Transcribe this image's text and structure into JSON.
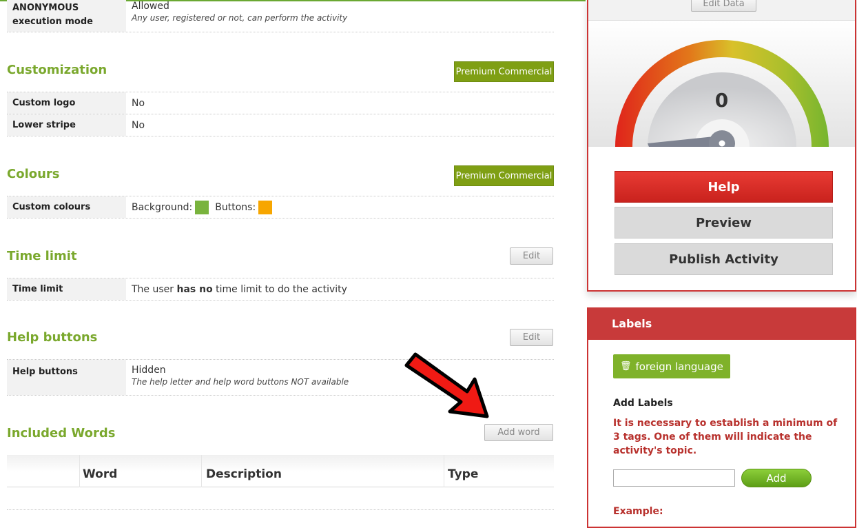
{
  "anonymous": {
    "label": "ANONYMOUS execution mode",
    "value": "Allowed",
    "sub": "Any user, registered or not, can perform the activity"
  },
  "customization": {
    "title": "Customization",
    "badge": "Premium Commercial",
    "rows": [
      {
        "label": "Custom logo",
        "value": "No"
      },
      {
        "label": "Lower stripe",
        "value": "No"
      }
    ]
  },
  "colours": {
    "title": "Colours",
    "badge": "Premium Commercial",
    "label": "Custom colours",
    "background_label": "Background:",
    "background_color": "#79b33d",
    "buttons_label": "Buttons:",
    "buttons_color": "#f7a600"
  },
  "time_limit": {
    "title": "Time limit",
    "edit": "Edit",
    "label": "Time limit",
    "value_pre": "The user ",
    "value_bold": "has no",
    "value_post": " time limit to do the activity"
  },
  "help_buttons": {
    "title": "Help buttons",
    "edit": "Edit",
    "label": "Help buttons",
    "value": "Hidden",
    "sub": "The help letter and help word buttons NOT available"
  },
  "included_words": {
    "title": "Included Words",
    "add": "Add word",
    "columns": [
      "Word",
      "Description",
      "Type"
    ]
  },
  "right_panel": {
    "edit_data": "Edit Data",
    "score": "0",
    "help": "Help",
    "preview": "Preview",
    "publish": "Publish Activity"
  },
  "labels_panel": {
    "title": "Labels",
    "tags": [
      "foreign language"
    ],
    "add_labels": "Add Labels",
    "warning": "It is necessary to establish a minimum of 3 tags. One of them will indicate the activity's topic.",
    "input_value": "",
    "add_button": "Add",
    "example": "Example:"
  },
  "colors": {
    "section_title": "#7aa82d",
    "premium": "#7f9f14",
    "help_red": "#e0302a",
    "panel_border": "#cc3333"
  }
}
